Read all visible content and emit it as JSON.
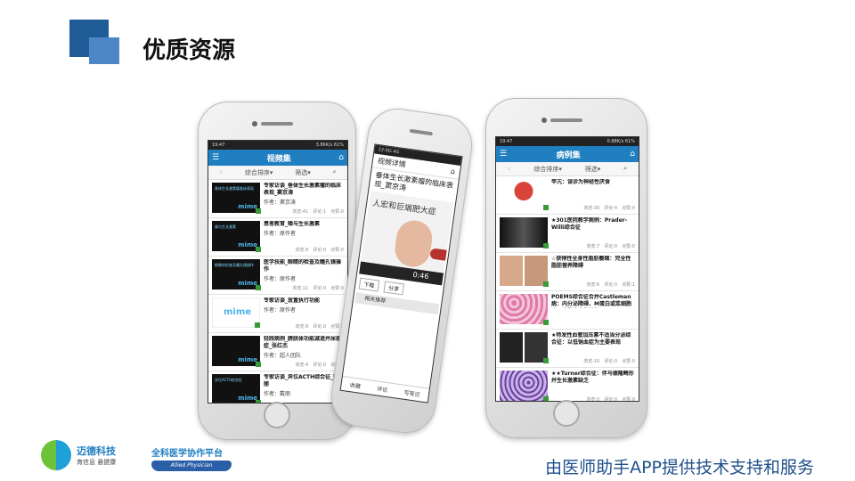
{
  "slide": {
    "title": "优质资源",
    "footer": "由医师助手APP提供技术支持和服务",
    "colors": {
      "accent_dark": "#1f5b96",
      "accent_light": "#4d86c6",
      "appbar": "#1f7fc1"
    }
  },
  "logos": {
    "maide": {
      "name": "迈德科技",
      "tagline": "育信息 悬健康"
    },
    "platform": {
      "name": "全科医学协作平台",
      "sub": "Allied Physician"
    }
  },
  "phone1": {
    "status_left": "19:47",
    "status_right": "3.86K/s 61%",
    "appbar_title": "视频集",
    "menu_icon": "menu-icon",
    "home_icon": "home-icon",
    "filter_sort": "综合排序",
    "filter_select": "筛选",
    "items": [
      {
        "title": "专家访谈_垂体生长激素瘤的临床表现_窦京涛",
        "author": "作者：窦京涛",
        "views": "浏览:41",
        "comments": "评论:1",
        "likes": "点赞:0",
        "thumb_text": "垂体生长激素瘤临床表现"
      },
      {
        "title": "患者教育_矮与生长激素",
        "author": "作者：原作者",
        "views": "浏览:9",
        "comments": "评论:0",
        "likes": "点赞:0",
        "thumb_text": "矮与生长激素"
      },
      {
        "title": "医学技能_眼睛的检查及瞳孔镜操作",
        "author": "作者：原作者",
        "views": "浏览:11",
        "comments": "评论:0",
        "likes": "点赞:0",
        "thumb_text": "眼睛的检查及瞳孔镜操作"
      },
      {
        "title": "专家访谈_放置执行功能",
        "author": "作者：原作者",
        "views": "浏览:9",
        "comments": "评论:0",
        "likes": "点赞:0",
        "thumb_text": ""
      },
      {
        "title": "轻践病例_膀胱体功能减退并尿崩症_张红杰",
        "author": "作者：超人团队",
        "views": "浏览:4",
        "comments": "评论:0",
        "likes": "点赞:0",
        "thumb_text": ""
      },
      {
        "title": "专家访谈_异位ACTH综合征_戴丽",
        "author": "作者：戴丽",
        "views": "",
        "comments": "",
        "likes": "",
        "thumb_text": "异位ACTH综合征"
      }
    ]
  },
  "phone2": {
    "status": "12:0G 4G",
    "header_title": "视频详情",
    "video_title": "垂体生长激素瘤的临床表现_窦京涛",
    "video_text": "人宏和巨端肥大症",
    "time": "0:46",
    "btn_download": "下载",
    "btn_share": "分享",
    "tab_related": "相关推荐",
    "bottom_fav": "收藏",
    "bottom_review": "评论",
    "bottom_note": "写笔记"
  },
  "phone3": {
    "status_left": "19:47",
    "status_right": "0.88K/s 61%",
    "appbar_title": "病例集",
    "filter_sort": "综合排序",
    "filter_select": "筛选",
    "items": [
      {
        "title": "甲亢：误诊为神经性厌食",
        "views": "浏览:30",
        "comments": "评论:4",
        "likes": "点赞:0",
        "thumb": "c-thyroid"
      },
      {
        "title": "★301医院教学病例：Prader-Willi综合征",
        "views": "浏览:7",
        "comments": "评论:0",
        "likes": "点赞:0",
        "thumb": "c-xray"
      },
      {
        "title": "☆获得性全身性脂肪萎缩：完全性脂肪营养障碍",
        "views": "浏览:6",
        "comments": "评论:0",
        "likes": "点赞:1",
        "thumb": "c-faces"
      },
      {
        "title": "POEMS综合征合并Castleman病：内分泌障碍、M蛋白或浆细胞病、皮肤病变为特征",
        "views": "",
        "comments": "",
        "likes": "",
        "thumb": "c-histo"
      },
      {
        "title": "★特发性血管加压素不适当分泌综合征：以低钠血症为主要表现",
        "views": "浏览:10",
        "comments": "评论:0",
        "likes": "点赞:0",
        "thumb": "c-mri"
      },
      {
        "title": "★★Turner综合征：伴马德隆畸形并生长激素缺乏",
        "views": "浏览:0",
        "comments": "评论:0",
        "likes": "点赞:0",
        "thumb": "c-purple"
      }
    ]
  }
}
